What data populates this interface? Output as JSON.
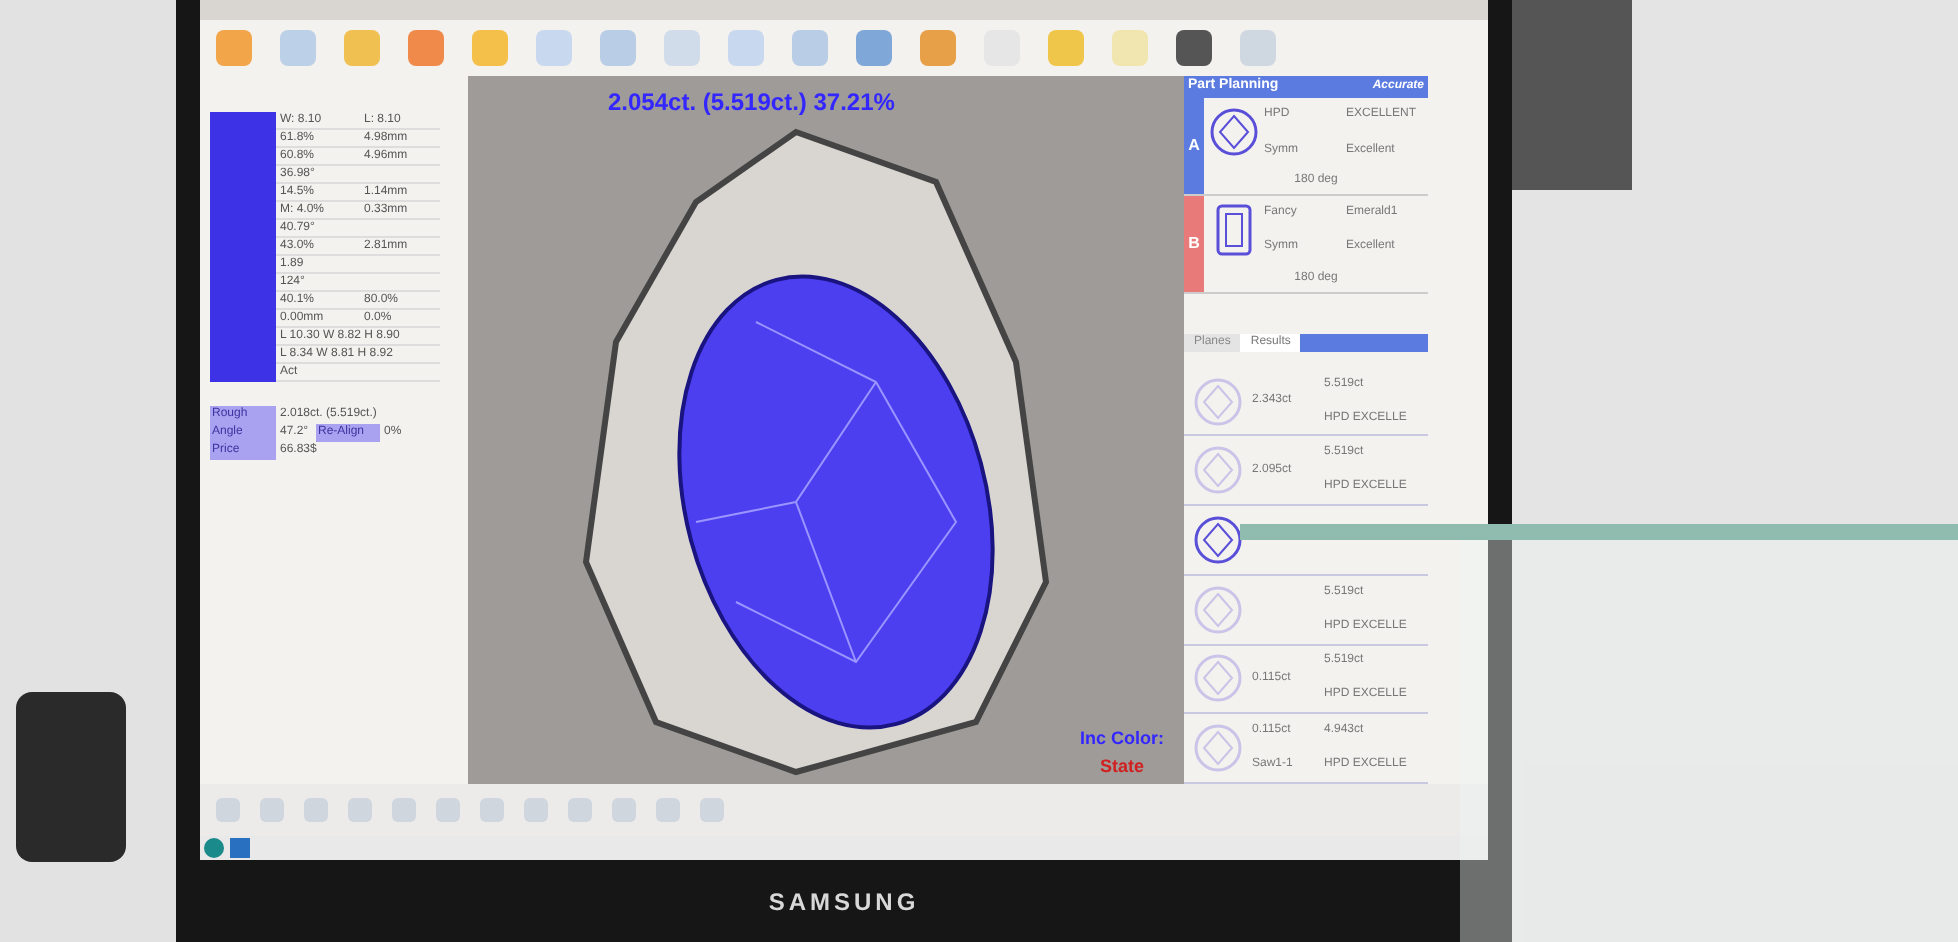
{
  "left_table": {
    "rows": [
      {
        "value_1": "W: 8.10",
        "value_2": "L: 8.10"
      },
      {
        "value_1": "61.8%",
        "value_2": "4.98mm"
      },
      {
        "value_1": "60.8%",
        "value_2": "4.96mm"
      },
      {
        "value_1": "36.98°"
      },
      {
        "value_1": "14.5%",
        "value_2": "1.14mm"
      },
      {
        "value_1": "M: 4.0%",
        "value_2": "0.33mm"
      },
      {
        "value_1": "40.79°"
      },
      {
        "value_1": "43.0%",
        "value_2": "2.81mm"
      },
      {
        "value_1": "1.89"
      },
      {
        "value_1": "124°"
      },
      {
        "value_1": "40.1%",
        "value_2": "80.0%"
      },
      {
        "value_1": "0.00mm",
        "value_2": "0.0%"
      },
      {
        "value_1": "L 10.30 W 8.82 H 8.90"
      },
      {
        "value_1": "L 8.34 W 8.81 H 8.92"
      },
      {
        "value_1": "Act"
      }
    ]
  },
  "summary": [
    {
      "label": "Rough",
      "value": "2.018ct. (5.519ct.)"
    },
    {
      "label": "Angle",
      "value": "47.2°",
      "button": "Re-Align",
      "extra": "0%"
    },
    {
      "label": "Price",
      "value": "66.83$"
    }
  ],
  "viewer": {
    "headline": "2.054ct. (5.519ct.) 37.21%",
    "legend_label": "Inc Color:",
    "legend_value": "State"
  },
  "part_planning": {
    "title": "Part Planning",
    "mode": "Accurate",
    "parts": [
      {
        "letter": "A",
        "color": "#5b7be0",
        "kind": "round",
        "shape": "HPD",
        "grade": "EXCELLENT",
        "symm_label": "Symm",
        "symm": "Excellent",
        "angle": "180 deg"
      },
      {
        "letter": "B",
        "color": "#e87a7a",
        "kind": "emerald",
        "shape": "Fancy",
        "grade": "Emerald1",
        "symm_label": "Symm",
        "symm": "Excellent",
        "angle": "180 deg"
      }
    ],
    "tabs": [
      {
        "label": "Planes",
        "selected": false
      },
      {
        "label": "Results",
        "selected": true
      }
    ],
    "results": [
      {
        "selected": false,
        "weight": "2.343ct",
        "rough": "5.519ct",
        "grade": "HPD EXCELLE"
      },
      {
        "selected": false,
        "weight": "2.095ct",
        "rough": "5.519ct",
        "grade": "HPD EXCELLE"
      },
      {
        "selected": true
      },
      {
        "selected": false,
        "rough": "5.519ct",
        "grade": "HPD EXCELLE"
      },
      {
        "selected": false,
        "weight": "0.115ct",
        "rough": "5.519ct",
        "grade": "HPD EXCELLE"
      },
      {
        "selected": false,
        "weight": "0.115ct",
        "rough": "4.943ct",
        "note": "Saw1-1",
        "grade": "HPD EXCELLE"
      }
    ]
  },
  "monitor": {
    "brand": "SAMSUNG"
  }
}
